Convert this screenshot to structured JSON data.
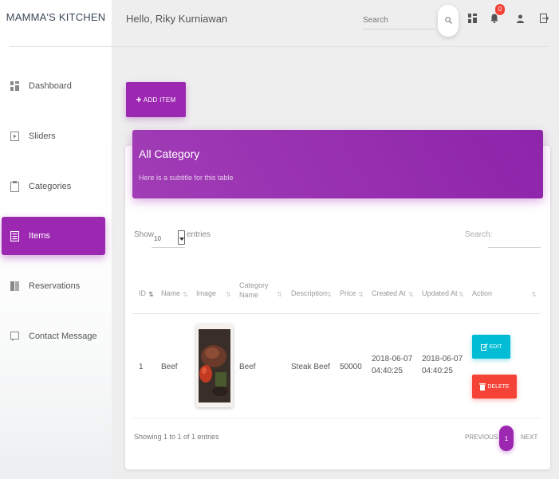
{
  "sidebar": {
    "brand": "MAMMA'S KITCHEN",
    "items": [
      {
        "label": "Dashboard",
        "icon": "dashboard-icon"
      },
      {
        "label": "Sliders",
        "icon": "slideshow-icon"
      },
      {
        "label": "Categories",
        "icon": "clipboard-icon"
      },
      {
        "label": "Items",
        "icon": "list-document-icon",
        "active": true
      },
      {
        "label": "Reservations",
        "icon": "book-icon"
      },
      {
        "label": "Contact Message",
        "icon": "message-icon"
      }
    ]
  },
  "topbar": {
    "greeting": "Hello, Riky Kurniawan",
    "search_placeholder": "Search",
    "notification_count": "0",
    "icons": [
      "search-icon",
      "dashboard-icon",
      "notifications-icon",
      "person-icon",
      "logout-icon"
    ]
  },
  "add_item_label": "ADD ITEM",
  "card": {
    "title": "All Category",
    "subtitle": "Here is a subtitle for this table"
  },
  "table_controls": {
    "show_label": "Show",
    "entries_value": "10",
    "entries_label": "entries",
    "search_label": "Search:"
  },
  "table": {
    "columns": [
      "ID",
      "Name",
      "Image",
      "Category Name",
      "Description",
      "Price",
      "Created At",
      "Updated At",
      "Action"
    ],
    "rows": [
      {
        "id": "1",
        "name": "Beef",
        "category": "Beef",
        "description": "Steak Beef",
        "price": "50000",
        "created_at": "2018-06-07 04:40:25",
        "updated_at": "2018-06-07 04:40:25",
        "edit_label": "EDIT",
        "delete_label": "DELETE"
      }
    ]
  },
  "footer": {
    "info": "Showing 1 to 1 of 1 entries",
    "previous": "PREVIOUS",
    "page": "1",
    "next": "NEXT"
  },
  "colors": {
    "primary": "#9c27b0",
    "info": "#00bcd4",
    "danger": "#f44336"
  }
}
